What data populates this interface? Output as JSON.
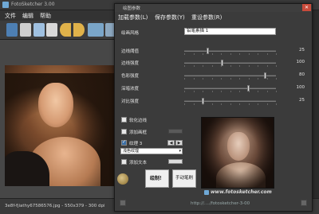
{
  "main": {
    "title": "FotoSketcher 3.00",
    "menu": [
      "文件",
      "编辑",
      "帮助"
    ],
    "status": "3e8f-fjiathy67586576.jpg - 550x379 - 300 dpi"
  },
  "dialog": {
    "title": "绘图参数",
    "close": "✕",
    "menu": [
      "加载参数(L)",
      "保存参数(Y)",
      "重设参数(R)"
    ],
    "style_label": "绘画风格",
    "style_value": "铅笔素描 1",
    "sliders": [
      {
        "label": "边线阈值",
        "value": "25",
        "level": 0.26
      },
      {
        "label": "边线强度",
        "value": "100",
        "level": 0.42
      },
      {
        "label": "色彩强度",
        "value": "80",
        "level": 0.89
      },
      {
        "label": "深暗浓度",
        "value": "100",
        "level": 0.7
      },
      {
        "label": "对比强度",
        "value": "25",
        "level": 0.21
      }
    ],
    "options": {
      "smooth_edges": {
        "label": "软化边线",
        "checked": false
      },
      "add_border": {
        "label": "添加画框",
        "checked": false
      },
      "texture": {
        "label": "纹理 3",
        "checked": true
      },
      "texture_select": "浅色纹理",
      "add_text": {
        "label": "添加文本",
        "checked": false
      }
    },
    "draw_button": "绘制！",
    "hand_button": "手动笔刷",
    "watermark": "www.fotosketcher.com",
    "url": "http://..../fotosketcher-3-00"
  }
}
